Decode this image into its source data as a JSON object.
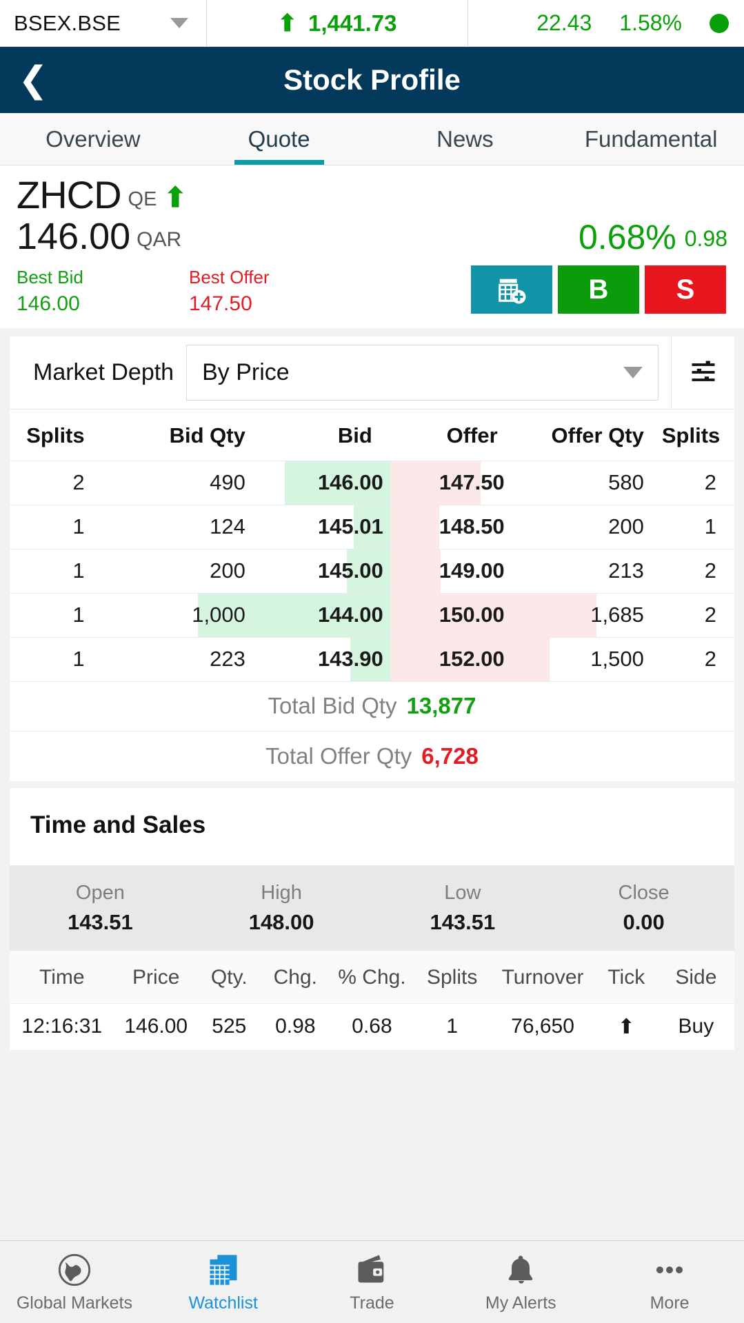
{
  "ticker": {
    "symbol": "BSEX.BSE",
    "dropdown_icon": "chevron-down-icon",
    "direction_icon": "arrow-up-icon",
    "value": "1,441.73",
    "change": "22.43",
    "change_pct": "1.58%",
    "status_icon": "status-dot-open",
    "up_color": "#0aa00a"
  },
  "navbar": {
    "back_icon": "chevron-left-icon",
    "title": "Stock Profile"
  },
  "tabs": [
    {
      "label": "Overview",
      "active": false
    },
    {
      "label": "Quote",
      "active": true
    },
    {
      "label": "News",
      "active": false
    },
    {
      "label": "Fundamental",
      "active": false
    }
  ],
  "quote": {
    "symbol": "ZHCD",
    "exchange": "QE",
    "trend_icon": "arrow-up-icon",
    "price": "146.00",
    "currency": "QAR",
    "change_pct": "0.68%",
    "net_change": "0.98",
    "best_bid_label": "Best Bid",
    "best_bid": "146.00",
    "best_offer_label": "Best Offer",
    "best_offer": "147.50",
    "buttons": [
      {
        "name": "add-to-watchlist-button",
        "label": "",
        "icon": "add-to-watchlist-icon",
        "color": "#1193a8"
      },
      {
        "name": "buy-button",
        "label": "B",
        "icon": "buy-icon",
        "color": "#0b9b0b"
      },
      {
        "name": "sell-button",
        "label": "S",
        "icon": "sell-icon",
        "color": "#e8151d"
      }
    ]
  },
  "market_depth": {
    "title": "Market Depth",
    "view_selected": "By Price",
    "dropdown_icon": "chevron-down-icon",
    "settings_icon": "sliders-settings-icon",
    "columns": [
      "Splits",
      "Bid Qty",
      "Bid",
      "Offer",
      "Offer Qty",
      "Splits"
    ],
    "rows": [
      {
        "bid_splits": "2",
        "bid_qty": "490",
        "bid": "146.00",
        "offer": "147.50",
        "offer_qty": "580",
        "offer_splits": "2",
        "bid_bar_pct": 14.5,
        "offer_bar_pct": 12.5
      },
      {
        "bid_splits": "1",
        "bid_qty": "124",
        "bid": "145.01",
        "offer": "148.50",
        "offer_qty": "200",
        "offer_splits": "1",
        "bid_bar_pct": 5.0,
        "offer_bar_pct": 6.8
      },
      {
        "bid_splits": "1",
        "bid_qty": "200",
        "bid": "145.00",
        "offer": "149.00",
        "offer_qty": "213",
        "offer_splits": "2",
        "bid_bar_pct": 6.0,
        "offer_bar_pct": 7.0
      },
      {
        "bid_splits": "1",
        "bid_qty": "1,000",
        "bid": "144.00",
        "offer": "150.00",
        "offer_qty": "1,685",
        "offer_splits": "2",
        "bid_bar_pct": 26.5,
        "offer_bar_pct": 28.5
      },
      {
        "bid_splits": "1",
        "bid_qty": "223",
        "bid": "143.90",
        "offer": "152.00",
        "offer_qty": "1,500",
        "offer_splits": "2",
        "bid_bar_pct": 5.5,
        "offer_bar_pct": 22.0
      }
    ],
    "total_bid_label": "Total Bid Qty",
    "total_bid": "13,877",
    "total_offer_label": "Total Offer Qty",
    "total_offer": "6,728"
  },
  "time_and_sales": {
    "title": "Time and Sales",
    "ohlc": [
      {
        "key": "Open",
        "value": "143.51"
      },
      {
        "key": "High",
        "value": "148.00"
      },
      {
        "key": "Low",
        "value": "143.51"
      },
      {
        "key": "Close",
        "value": "0.00"
      }
    ],
    "columns": [
      "Time",
      "Price",
      "Qty.",
      "Chg.",
      "% Chg.",
      "Splits",
      "Turnover",
      "Tick",
      "Side"
    ],
    "trades": [
      {
        "time": "12:16:31",
        "price": "146.00",
        "qty": "525",
        "chg": "0.98",
        "pct_chg": "0.68",
        "splits": "1",
        "turnover": "76,650",
        "tick_icon": "arrow-up-icon",
        "side": "Buy"
      }
    ]
  },
  "bottom_nav": [
    {
      "label": "Global Markets",
      "icon": "globe-icon",
      "active": false
    },
    {
      "label": "Watchlist",
      "icon": "watchlist-icon",
      "active": true
    },
    {
      "label": "Trade",
      "icon": "wallet-icon",
      "active": false
    },
    {
      "label": "My Alerts",
      "icon": "bell-icon",
      "active": false
    },
    {
      "label": "More",
      "icon": "ellipsis-icon",
      "active": false
    }
  ]
}
